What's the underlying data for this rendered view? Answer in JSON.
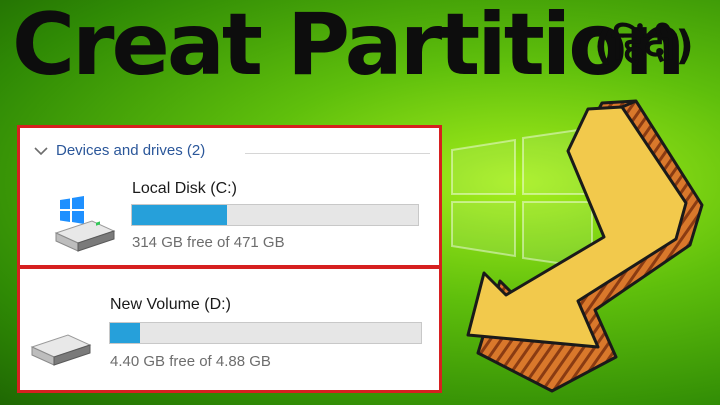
{
  "title": "Creat Partition",
  "subtitle": "(हिंदी)",
  "explorer": {
    "group_header": "Devices and drives (2)",
    "drives": [
      {
        "name": "Local Disk (C:)",
        "free_text": "314 GB free of 471 GB",
        "used_fraction": 0.333,
        "icon": "windows-drive-icon"
      },
      {
        "name": "New Volume (D:)",
        "free_text": "4.40 GB free of 4.88 GB",
        "used_fraction": 0.098,
        "icon": "hard-drive-icon"
      }
    ]
  },
  "colors": {
    "accent_bar": "#26a0da",
    "panel_border": "#d62020",
    "arrow_fill": "#f2c94c",
    "arrow_stripes": "#b5541f",
    "background": "#5fbf0c"
  }
}
